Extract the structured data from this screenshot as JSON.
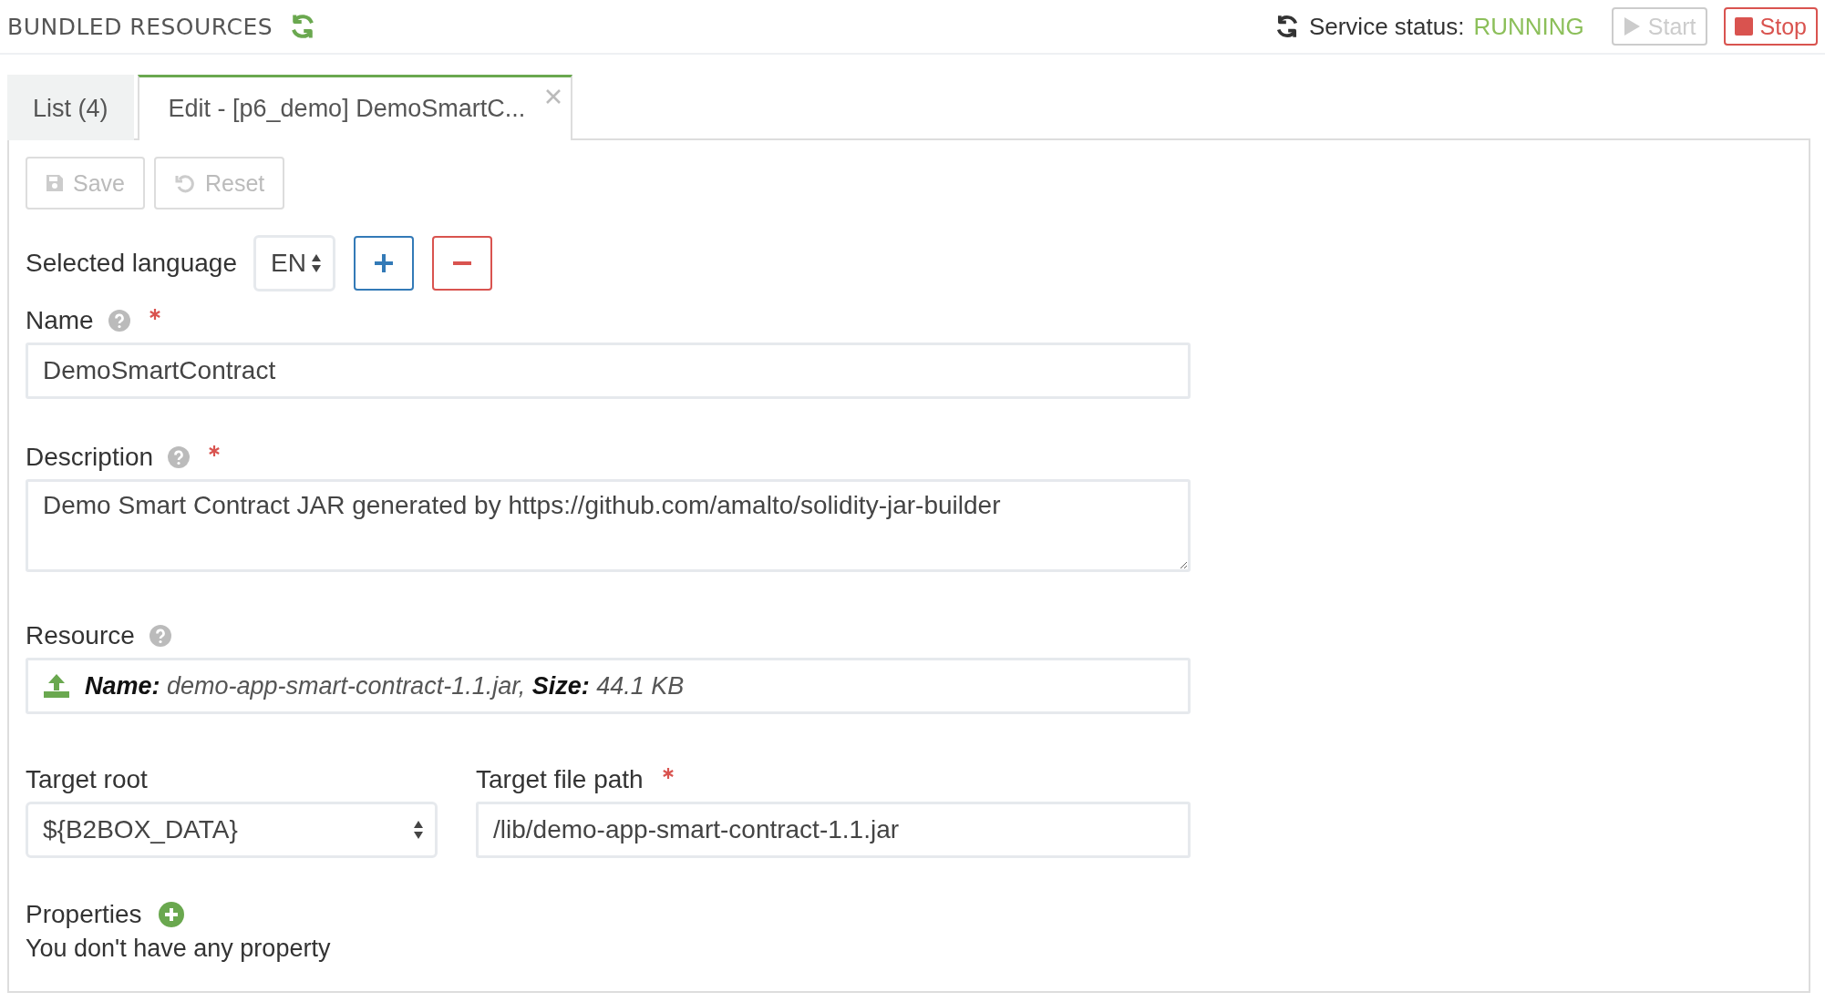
{
  "header": {
    "title": "BUNDLED RESOURCES",
    "status_label": "Service status:",
    "status_value": "RUNNING",
    "buttons": [
      {
        "kind": "start",
        "label": "Start",
        "disabled": true
      },
      {
        "kind": "stop",
        "label": "Stop",
        "disabled": false
      }
    ]
  },
  "tabs": [
    {
      "label": "List (4)",
      "selected": false,
      "closable": false
    },
    {
      "label": "Edit - [p6_demo] DemoSmartC...",
      "selected": true,
      "closable": true
    }
  ],
  "toolbar": [
    {
      "kind": "save",
      "label": "Save",
      "disabled": true
    },
    {
      "kind": "reset",
      "label": "Reset",
      "disabled": true
    }
  ],
  "language": {
    "label": "Selected language",
    "value": "EN"
  },
  "fields": [
    {
      "kind": "input",
      "label": "Name",
      "help": true,
      "required": true,
      "value": "DemoSmartContract"
    },
    {
      "kind": "textarea",
      "label": "Description",
      "help": true,
      "required": true,
      "value": "Demo Smart Contract JAR generated by https://github.com/amalto/solidity-jar-builder"
    },
    {
      "kind": "file",
      "label": "Resource",
      "help": true,
      "required": false,
      "value": "**Name:** demo-app-smart-contract-1.1.jar, **Size:** 44.1 KB"
    }
  ],
  "target_root": {
    "label": "Target root",
    "required": false,
    "value": "${B2BOX_DATA}"
  },
  "target_file_path": {
    "label": "Target file path",
    "required": true,
    "value": "/lib/demo-app-smart-contract-1.1.jar"
  },
  "properties": {
    "label": "Properties",
    "empty_text": "You don't have any property"
  }
}
